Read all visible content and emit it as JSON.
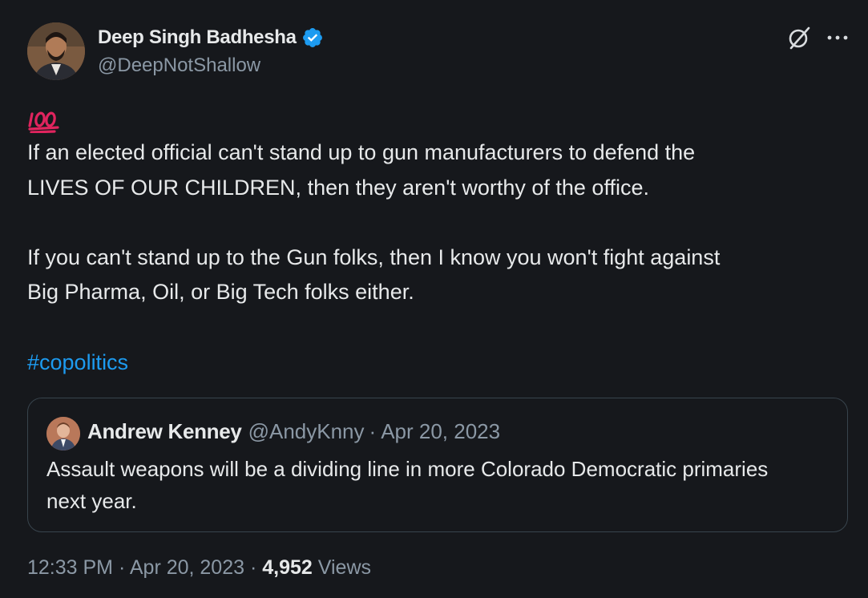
{
  "author": {
    "display_name": "Deep Singh Badhesha",
    "handle": "@DeepNotShallow",
    "verified": true,
    "verified_color": "#1d9bf0"
  },
  "header_actions": {
    "grok_icon": "grok-icon",
    "more_icon": "more-icon"
  },
  "tweet": {
    "emoji": "100-emoji",
    "paragraph1_line1": "If an elected official can't stand up to gun manufacturers to defend the",
    "paragraph1_line2": "LIVES OF OUR CHILDREN, then they aren't worthy of the office.",
    "paragraph2_line1": "If you can't stand up to the Gun folks, then I know you won't fight against",
    "paragraph2_line2": "Big Pharma, Oil, or Big Tech folks either.",
    "hashtag": "#copolitics",
    "link_color": "#1d9bf0"
  },
  "quoted_tweet": {
    "display_name": "Andrew Kenney",
    "handle": "@AndyKnny",
    "separator": "·",
    "date": "Apr 20, 2023",
    "text_line1": "Assault weapons will be a dividing line in more Colorado Democratic primaries",
    "text_line2": "next year."
  },
  "footer": {
    "time": "12:33 PM",
    "sep1": " · ",
    "date": "Apr 20, 2023",
    "sep2": " · ",
    "views_count": "4,952",
    "views_label": " Views"
  }
}
